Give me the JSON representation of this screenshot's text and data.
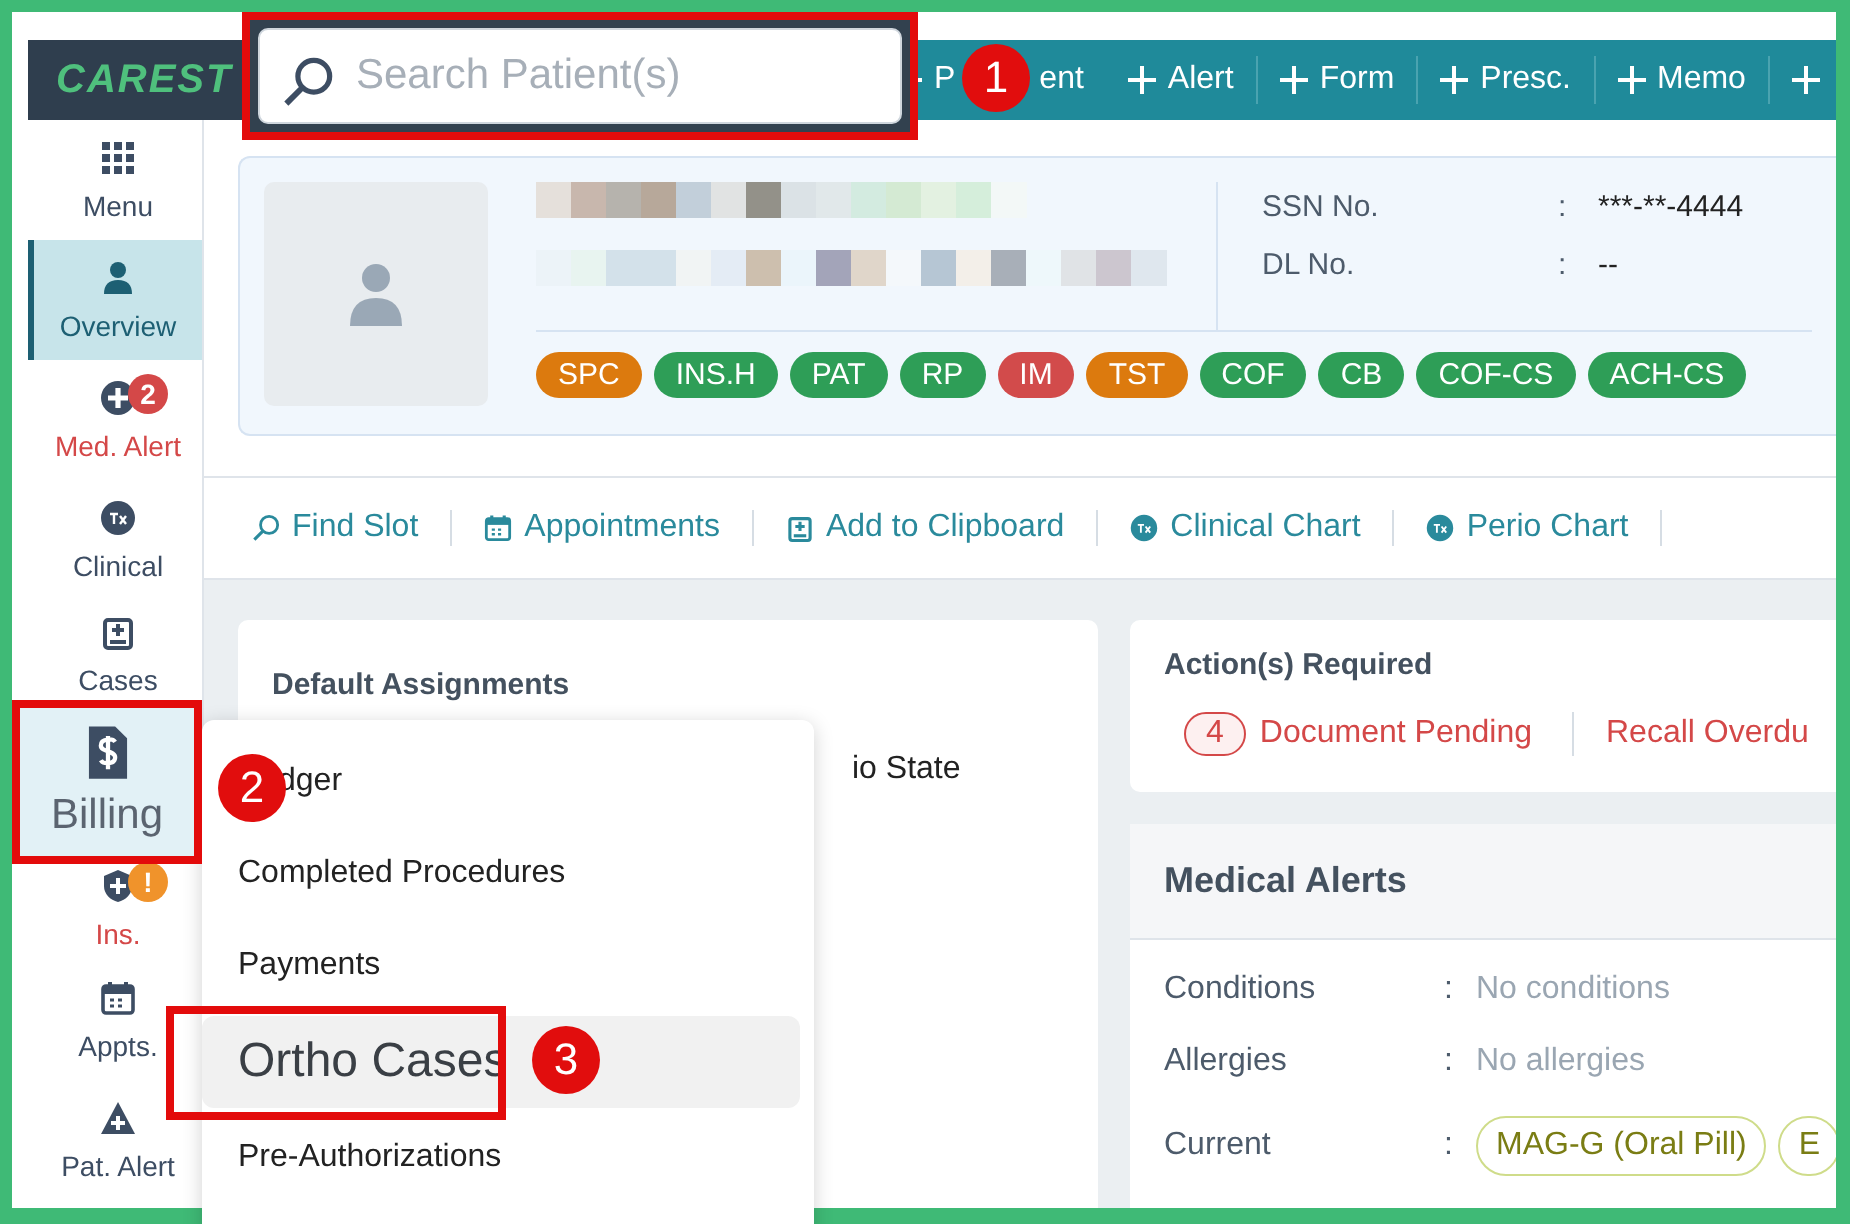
{
  "header": {
    "logo": "CAREST",
    "search": {
      "placeholder": "Search Patient(s)"
    },
    "actions": [
      {
        "kind": "split",
        "label": "P",
        "label_end": "ent"
      },
      {
        "kind": "text",
        "label": "Alert"
      },
      {
        "kind": "text",
        "label": "Form"
      },
      {
        "kind": "text",
        "label": "Presc."
      },
      {
        "kind": "text",
        "label": "Memo"
      },
      {
        "kind": "icon"
      }
    ]
  },
  "sidebar": {
    "items": [
      {
        "label": "Menu",
        "selected": false,
        "alert": false,
        "callout": false
      },
      {
        "label": "Overview",
        "selected": true,
        "alert": false,
        "callout": false
      },
      {
        "label": "Med. Alert",
        "selected": false,
        "alert": true,
        "callout": false,
        "badge": {
          "text": "2",
          "color": "#d44848"
        }
      },
      {
        "label": "Clinical",
        "selected": false,
        "alert": false,
        "callout": false
      },
      {
        "label": "Cases",
        "selected": false,
        "alert": false,
        "callout": false
      },
      {
        "label": "Billing",
        "selected": false,
        "alert": false,
        "callout": true
      },
      {
        "label": "Ins.",
        "selected": false,
        "alert": true,
        "callout": false,
        "badge": {
          "text": "!",
          "color": "#f0932b"
        }
      },
      {
        "label": "Appts.",
        "selected": false,
        "alert": false,
        "callout": false
      },
      {
        "label": "Pat. Alert",
        "selected": false,
        "alert": false,
        "callout": false
      }
    ]
  },
  "patient": {
    "fields": [
      {
        "label": "SSN No.",
        "separator": ":",
        "value": "***-**-4444"
      },
      {
        "label": "DL No.",
        "separator": ":",
        "value": "--"
      }
    ],
    "tags": [
      {
        "text": "SPC",
        "color": "#dc7a0e"
      },
      {
        "text": "INS.H",
        "color": "#2e9e57"
      },
      {
        "text": "PAT",
        "color": "#2e9e57"
      },
      {
        "text": "RP",
        "color": "#2e9e57"
      },
      {
        "text": "IM",
        "color": "#d24b4b"
      },
      {
        "text": "TST",
        "color": "#dc7a0e"
      },
      {
        "text": "COF",
        "color": "#2e9e57"
      },
      {
        "text": "CB",
        "color": "#2e9e57"
      },
      {
        "text": "COF-CS",
        "color": "#2e9e57"
      },
      {
        "text": "ACH-CS",
        "color": "#2e9e57"
      }
    ]
  },
  "toolbar": [
    {
      "label": "Find Slot"
    },
    {
      "label": "Appointments"
    },
    {
      "label": "Add to Clipboard"
    },
    {
      "label": "Clinical Chart"
    },
    {
      "label": "Perio Chart"
    }
  ],
  "assignments": {
    "title": "Default Assignments",
    "partial_text": "io State"
  },
  "billing_menu": [
    {
      "label": "dger",
      "selected": false
    },
    {
      "label": "Completed Procedures",
      "selected": false
    },
    {
      "label": "Payments",
      "selected": false
    },
    {
      "label": "Ortho Cases",
      "selected": true
    },
    {
      "label": "Pre-Authorizations",
      "selected": false
    }
  ],
  "actions_required": {
    "title": "Action(s) Required",
    "items": [
      {
        "count": "4",
        "label": "Document Pending"
      },
      {
        "label": "Recall Overdu"
      }
    ]
  },
  "medical_alerts": {
    "title": "Medical Alerts",
    "rows": [
      {
        "kind": "text",
        "label": "Conditions",
        "separator": ":",
        "value": "No conditions"
      },
      {
        "kind": "text",
        "label": "Allergies",
        "separator": ":",
        "value": "No allergies"
      },
      {
        "kind": "pills",
        "label": "Current",
        "separator": ":",
        "pills": [
          "MAG-G (Oral Pill)",
          "E"
        ]
      }
    ]
  },
  "annotations": [
    {
      "number": "1"
    },
    {
      "number": "2"
    },
    {
      "number": "3"
    }
  ]
}
